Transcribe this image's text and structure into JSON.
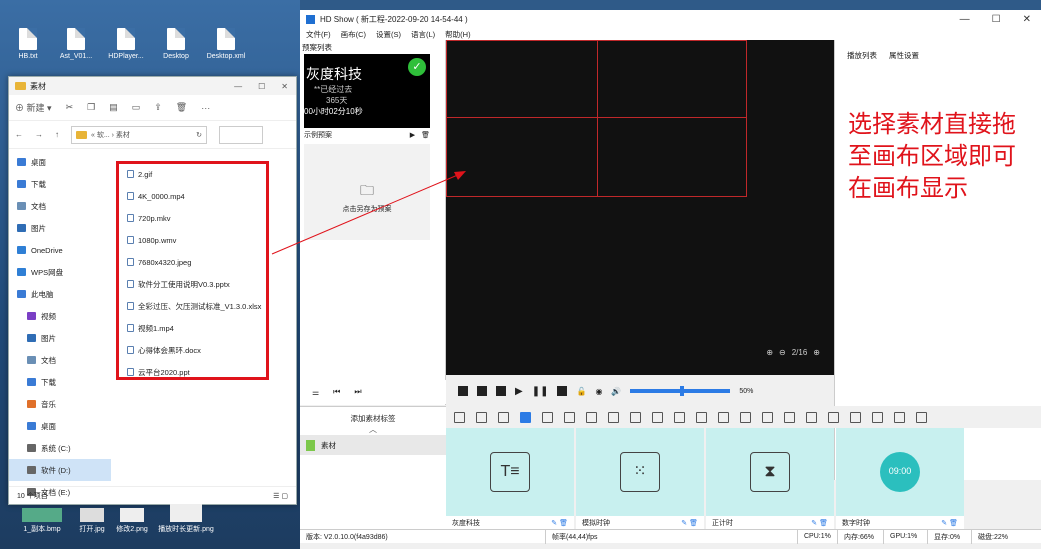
{
  "desktop": {
    "icons": [
      "HB.txt",
      "Ast_V01...",
      "HDPlayer...",
      "Desktop",
      "Desktop.xml"
    ],
    "taskbar_thumbs": [
      "1_副本.bmp",
      "打开.jpg",
      "修改2.png",
      "播放时长更新.png"
    ]
  },
  "explorer": {
    "title": "素材",
    "toolbar": {
      "new_label": "新建"
    },
    "address": "« 软... › 素材",
    "sidebar": [
      {
        "label": "桌面",
        "icon": "desktop-icon"
      },
      {
        "label": "下载",
        "icon": "download-icon"
      },
      {
        "label": "文档",
        "icon": "document-icon"
      },
      {
        "label": "图片",
        "icon": "picture-icon"
      },
      {
        "label": "OneDrive",
        "icon": "cloud-icon"
      },
      {
        "label": "WPS网盘",
        "icon": "cloud-icon"
      },
      {
        "label": "此电脑",
        "icon": "computer-icon"
      },
      {
        "label": "视频",
        "icon": "video-icon"
      },
      {
        "label": "图片",
        "icon": "picture-icon"
      },
      {
        "label": "文档",
        "icon": "document-icon"
      },
      {
        "label": "下载",
        "icon": "download-icon"
      },
      {
        "label": "音乐",
        "icon": "music-icon"
      },
      {
        "label": "桌面",
        "icon": "desktop-icon"
      },
      {
        "label": "系统 (C:)",
        "icon": "drive-icon"
      },
      {
        "label": "软件 (D:)",
        "icon": "drive-icon"
      },
      {
        "label": "文档 (E:)",
        "icon": "drive-icon"
      }
    ],
    "files": [
      "2.gif",
      "4K_0000.mp4",
      "720p.mkv",
      "1080p.wmv",
      "7680x4320.jpeg",
      "软件分工使用说明V0.3.pptx",
      "全彩过压、欠压测试标准_V1.3.0.xlsx",
      "视频1.mp4",
      "心得体会黑环.docx",
      "云平台2020.ppt"
    ],
    "status": "10 个项目"
  },
  "app": {
    "title": "HD Show ( 新工程-2022-09-20 14-54-44 )",
    "menu": [
      "文件(F)",
      "画布(C)",
      "设置(S)",
      "语言(L)",
      "帮助(H)"
    ],
    "left_title": "预案列表",
    "preview": {
      "line1": "灰度科技",
      "line2": "**已经过去",
      "line3": "365天",
      "line4": "00小时02分10秒",
      "caption": "示例预案"
    },
    "save_plan": "点击另存为预案",
    "right_tabs": [
      "播放列表",
      "属性设置"
    ],
    "annotation": "选择素材直接拖至画布区域即可在画布显示",
    "zoom": "2/16",
    "volume_label": "50%",
    "volume_value": 0.5,
    "add_tag": "添加素材标签",
    "tag_item": "素材",
    "cards": [
      {
        "label": "灰度科技",
        "icon": "text-icon"
      },
      {
        "label": "模拟时钟",
        "icon": "clock-icon"
      },
      {
        "label": "正计时",
        "icon": "hourglass-icon"
      },
      {
        "label": "数字时钟",
        "icon": "digital-clock-icon",
        "text": "09:00"
      }
    ],
    "status": {
      "version": "版本: V2.0.10.0(f4a93d86)",
      "fps": "帧率(44,44)fps",
      "cpu": "CPU:1%",
      "mem": "内存:66%",
      "gpu": "GPU:1%",
      "vram": "显存:0%",
      "disk": "磁盘:22%"
    }
  }
}
